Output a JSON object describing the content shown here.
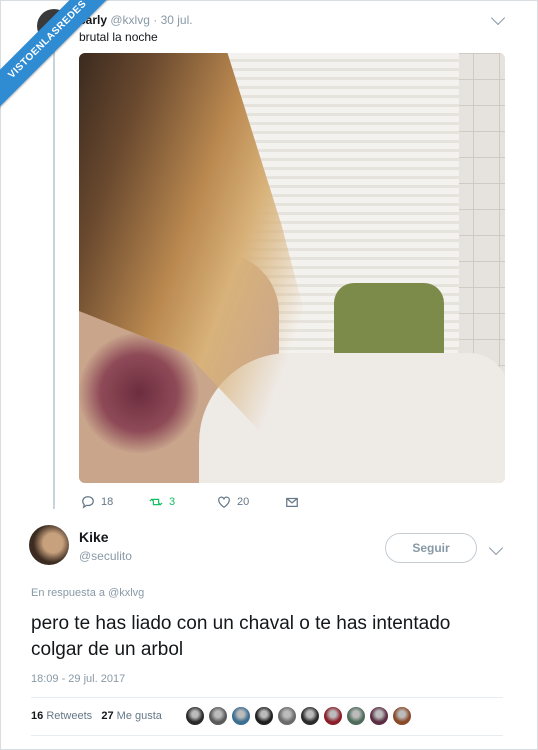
{
  "watermark": "VISTOENLASREDES",
  "original_tweet": {
    "name": "carly",
    "handle": "@kxlvg",
    "date": "· 30 jul.",
    "text": "brutal la noche",
    "actions": {
      "replies": "18",
      "retweets": "3",
      "likes": "20"
    }
  },
  "reply_tweet": {
    "name": "Kike",
    "handle": "@seculito",
    "follow_label": "Seguir",
    "replying_prefix": "En respuesta a",
    "replying_to": "@kxlvg",
    "text": "pero te has liado con un chaval o te has intentado colgar de un arbol",
    "timestamp": "18:09 - 29 jul. 2017",
    "retweets_count": "16",
    "retweets_label": "Retweets",
    "likes_count": "27",
    "likes_label": "Me gusta"
  },
  "colors": {
    "accent": "#1da1f2",
    "retweet": "#17bf63",
    "muted": "#8899a6",
    "watermark": "#2f8bd2"
  },
  "likers": [
    "#2a2a2a",
    "#5a5a5a",
    "#3b6e8f",
    "#1f1f1f",
    "#6a6a6a",
    "#2b2b2b",
    "#8a1f2a",
    "#4f6b5a",
    "#5b2e44",
    "#8a4a2a"
  ]
}
